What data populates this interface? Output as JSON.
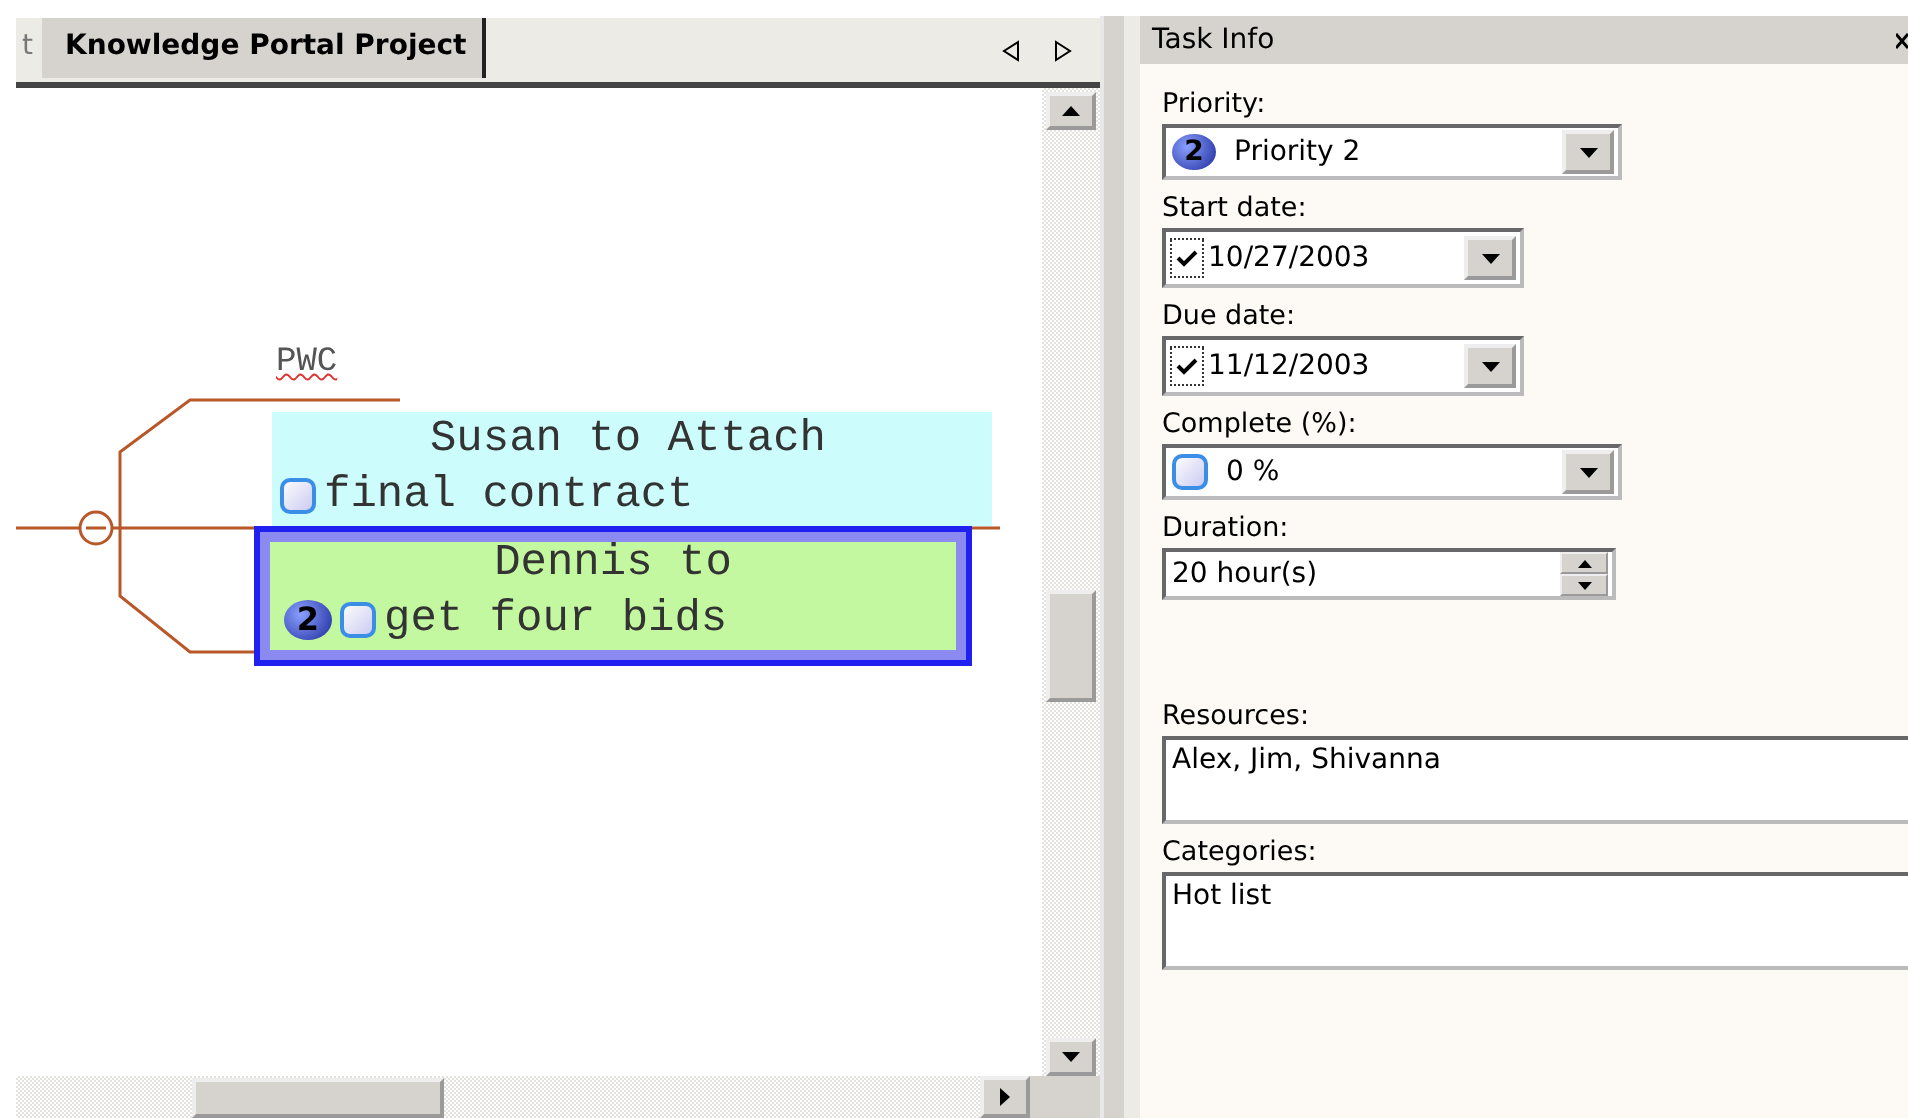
{
  "tabs": [
    {
      "label": "t",
      "selected": false
    },
    {
      "label": "Knowledge Portal Project",
      "selected": true
    }
  ],
  "map": {
    "branch": "PWC",
    "topics": [
      {
        "lines": [
          "Susan to Attach",
          "final contract"
        ],
        "checked": false,
        "selected": false,
        "color": "#ccfcfc"
      },
      {
        "lines": [
          "Dennis to",
          "get four bids"
        ],
        "priority": "2",
        "checked": false,
        "selected": true,
        "color": "#c4f8a0"
      }
    ]
  },
  "task_info": {
    "title": "Task Info",
    "fields": [
      {
        "kind": "priority",
        "label": "Priority:",
        "badge": "2",
        "value": "Priority 2"
      },
      {
        "kind": "date",
        "label": "Start date:",
        "checked": true,
        "value": "10/27/2003"
      },
      {
        "kind": "date",
        "label": "Due date:",
        "checked": true,
        "value": "11/12/2003"
      },
      {
        "kind": "progress",
        "label": "Complete (%):",
        "value": "0 %"
      },
      {
        "kind": "spin",
        "label": "Duration:",
        "value": "20 hour(s)"
      },
      {
        "kind": "text",
        "label": "Resources:",
        "value": "Alex, Jim, Shivanna"
      },
      {
        "kind": "text",
        "label": "Categories:",
        "value": "Hot list"
      }
    ]
  }
}
